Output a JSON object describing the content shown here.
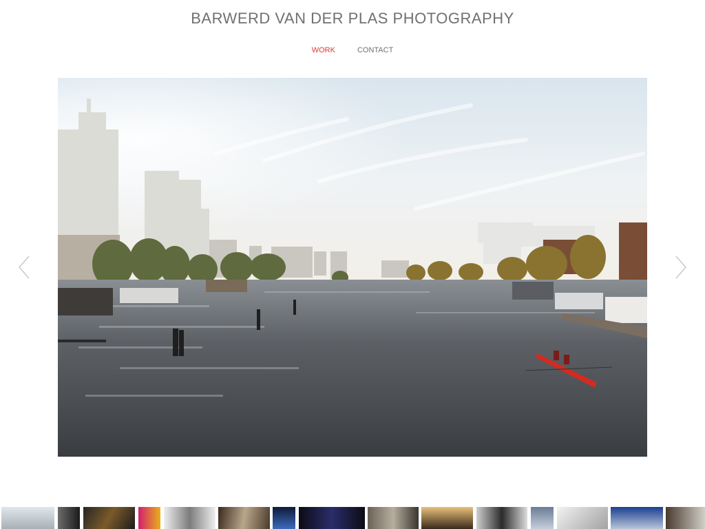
{
  "site": {
    "title": "BARWERD VAN DER PLAS PHOTOGRAPHY"
  },
  "nav": {
    "items": [
      {
        "label": "WORK",
        "active": true
      },
      {
        "label": "CONTACT",
        "active": false
      }
    ]
  },
  "colors": {
    "accent": "#e03a2f",
    "text": "#707070",
    "background": "#ffffff"
  },
  "slider": {
    "prev_icon": "chevron-left-icon",
    "next_icon": "chevron-right-icon"
  },
  "thumbnails": {
    "count": 16
  }
}
